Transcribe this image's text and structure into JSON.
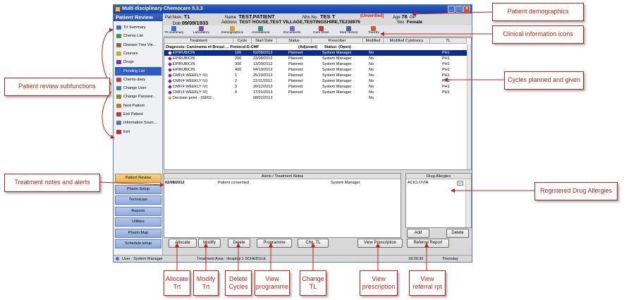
{
  "window": {
    "title": "Multi disciplinary Chemocare 5.3.3"
  },
  "sidebar": {
    "header": "Patient Review",
    "items": [
      {
        "label": "Trt Summary",
        "color": "#3b6bd6"
      },
      {
        "label": "Chemo List",
        "color": "#3b9b3b"
      },
      {
        "label": "Disease Tree Vie...",
        "color": "#8a6a2a"
      },
      {
        "label": "Courses",
        "color": "#d6a22a"
      },
      {
        "label": "Drugs",
        "color": "#6a3ab6"
      },
      {
        "label": "Pending List",
        "color": "#2a6ad6"
      },
      {
        "label": "Chemo diary",
        "color": "#c63a3a"
      },
      {
        "label": "Change User",
        "color": "#3a8a8a"
      },
      {
        "label": "Change Passwor...",
        "color": "#8a8a2a"
      },
      {
        "label": "Next Patient",
        "color": "#c67a2a"
      },
      {
        "label": "Exit Patient",
        "color": "#b63a3a"
      },
      {
        "label": "Information Sourc...",
        "color": "#4a7ab6"
      },
      {
        "label": "Exit",
        "color": "#c62a2a"
      }
    ],
    "buttons": [
      "Patient Review",
      "Pharm Setup",
      "Technician",
      "Reports",
      "Utilities",
      "Pharm.Map",
      "Schedule setup"
    ]
  },
  "patient": {
    "patnum_label": "Pat.Num.",
    "patnum": "T1",
    "name_label": "Name",
    "name": "TEST,PATIENT",
    "nhs_label": "Nhs No.",
    "nhs": "TES T",
    "unverified": "(Unverified)",
    "age_label": "Age",
    "age": "78",
    "gp": "GP",
    "dob_label": "Dob",
    "dob": "09/09/1933",
    "address_label": "Address",
    "address": "TEST HOUSE,TEST VILLAGE,TESTINGSHIRE,TE238976",
    "sex_label": "Sex",
    "sex": "Female"
  },
  "toolbar": [
    "Trt Summary",
    "Laboratory",
    "Demographics",
    "Annotations",
    "Documents",
    "Cum Dose",
    "Med History",
    "Toxicity"
  ],
  "grid": {
    "headers": [
      "Treatment",
      "Cycle",
      "Start Date",
      "Status",
      "Prescriber",
      "Modified",
      "Modified Cytotoxics",
      "TL"
    ],
    "diagnosis": "Diagnosis: Carcinoma of Breast ... Protocol:E-CMF",
    "adjuvant": "(Adjuvant)",
    "status_open": "Status: (Open)",
    "rows": [
      {
        "treatment": "EPIRUBICIN",
        "cycle": "100",
        "date": "02/08/2012",
        "status": "Planned",
        "prescriber": "System Manager",
        "modified": "No",
        "tl": "PH1"
      },
      {
        "treatment": "EPIRUBICIN",
        "cycle": "200",
        "date": "23/08/2012",
        "status": "Planned",
        "prescriber": "System Manager",
        "modified": "No",
        "tl": "PH1"
      },
      {
        "treatment": "EPIRUBICIN",
        "cycle": "300",
        "date": "13/09/2012",
        "status": "Planned",
        "prescriber": "System Manager",
        "modified": "No",
        "tl": "PH1"
      },
      {
        "treatment": "EPIRUBICIN",
        "cycle": "400",
        "date": "04/10/2012",
        "status": "Planned",
        "prescriber": "System Manager",
        "modified": "No",
        "tl": "PH1"
      },
      {
        "treatment": "CMF(4 WEEKLY IV)",
        "cycle": "1",
        "date": "25/10/2012",
        "status": "Planned",
        "prescriber": "System Manager",
        "modified": "No",
        "tl": "PH1"
      },
      {
        "treatment": "CMF(4 WEEKLY IV)",
        "cycle": "2",
        "date": "22/11/2012",
        "status": "Planned",
        "prescriber": "System Manager",
        "modified": "No",
        "tl": "PH1"
      },
      {
        "treatment": "CMF(4 WEEKLY IV)",
        "cycle": "3",
        "date": "20/12/2012",
        "status": "Planned",
        "prescriber": "System Manager",
        "modified": "No",
        "tl": "PH1"
      },
      {
        "treatment": "CMF(4 WEEKLY IV)",
        "cycle": "4",
        "date": "17/01/2013",
        "status": "Planned",
        "prescriber": "System Manager",
        "modified": "No",
        "tl": "PH1"
      },
      {
        "treatment": "Decision point - (08/02...",
        "cycle": "",
        "date": "08/02/2013",
        "status": "",
        "prescriber": "",
        "modified": "No",
        "tl": ""
      }
    ]
  },
  "notes": {
    "header": "Alerts / Treatment Notes",
    "date": "02/08/2012",
    "text": "Patient consented",
    "author": "System Manager"
  },
  "allergies": {
    "header": "Drug Allergies",
    "item": "ACICLOVIR",
    "add": "Add",
    "delete": "Delete"
  },
  "buttons": {
    "allocate": "Allocate",
    "modify": "Modify",
    "delete": "Delete",
    "programme": "Programme",
    "chg_tl": "Chg. TL",
    "view_prescription": "View Prescription",
    "referral": "Referral Report"
  },
  "status": {
    "user": "User : System Manager",
    "area": "Treatment Area : Hospital 1 SCHEDULE",
    "time": "18:39:36",
    "day": "Thursday"
  },
  "callouts": {
    "demographics": "Patient demographics",
    "clinical_icons": "Clinical information icons",
    "cycles": "Cycles planned and given",
    "subfunctions": "Patient review subfunctions",
    "notes_alerts": "Treatment notes and alerts",
    "allergies": "Registered Drug Allergies",
    "allocate": "Allocate Trt",
    "modify": "Modify Trt",
    "delete": "Delete Cycles",
    "programme": "View programme",
    "change_tl": "Change TL",
    "prescription": "View prescription",
    "referral": "View referral rpt"
  }
}
